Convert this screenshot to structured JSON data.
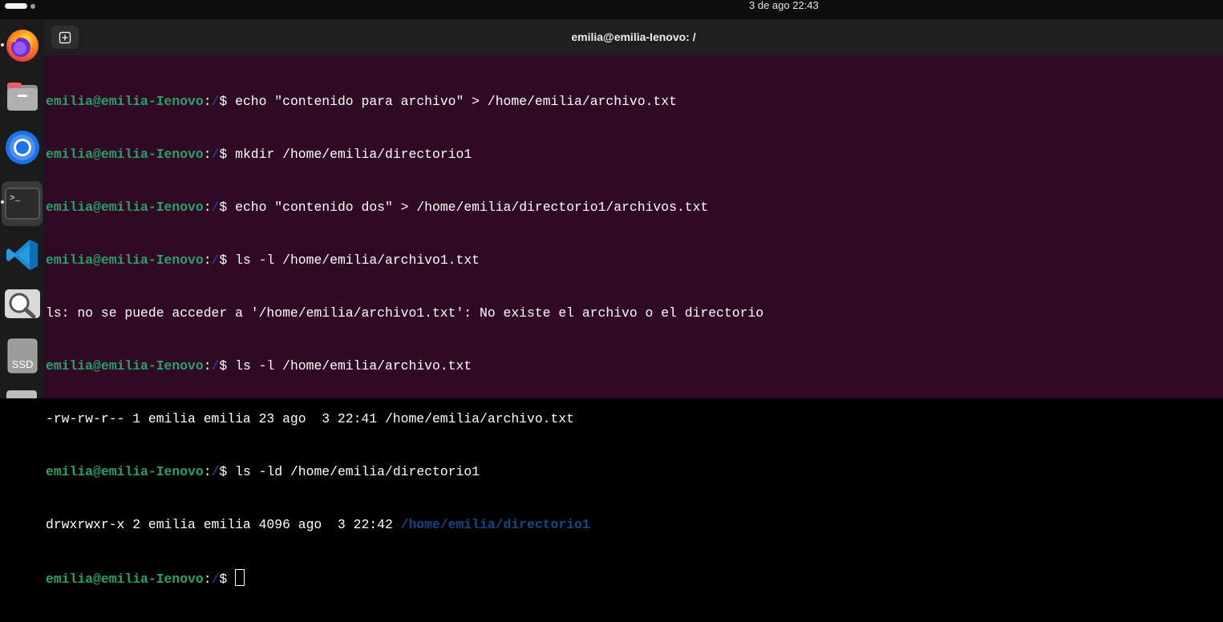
{
  "topbar": {
    "clock": "3 de ago  22:43"
  },
  "dock": {
    "items": [
      {
        "name": "firefox-icon"
      },
      {
        "name": "files-icon"
      },
      {
        "name": "chromium-icon"
      },
      {
        "name": "terminal-icon"
      },
      {
        "name": "vscode-icon"
      },
      {
        "name": "image-viewer-icon"
      },
      {
        "name": "ssd-drive-icon",
        "label": "SSD"
      }
    ]
  },
  "window": {
    "title": "emilia@emilia-Ienovo: /"
  },
  "terminal": {
    "prompt_user": "emilia@emilia-Ienovo",
    "prompt_path": "/",
    "prompt_sep": ":",
    "prompt_symbol": "$",
    "lines": [
      {
        "cmd": " echo \"contenido para archivo\" > /home/emilia/archivo.txt"
      },
      {
        "cmd": " mkdir /home/emilia/directorio1"
      },
      {
        "cmd": " echo \"contenido dos\" > /home/emilia/directorio1/archivos.txt"
      },
      {
        "cmd": " ls -l /home/emilia/archivo1.txt"
      },
      {
        "out": "ls: no se puede acceder a '/home/emilia/archivo1.txt': No existe el archivo o el directorio"
      },
      {
        "cmd": " ls -l /home/emilia/archivo.txt"
      },
      {
        "out": "-rw-rw-r-- 1 emilia emilia 23 ago  3 22:41 /home/emilia/archivo.txt"
      },
      {
        "cmd": " ls -ld /home/emilia/directorio1"
      },
      {
        "out_prefix": "drwxrwxr-x 2 emilia emilia 4096 ago  3 22:42 ",
        "out_dir": "/home/emilia/directorio1"
      }
    ]
  },
  "colors": {
    "terminal_bg": "#300a24",
    "prompt_user": "#26a269",
    "prompt_path": "#12488b"
  }
}
